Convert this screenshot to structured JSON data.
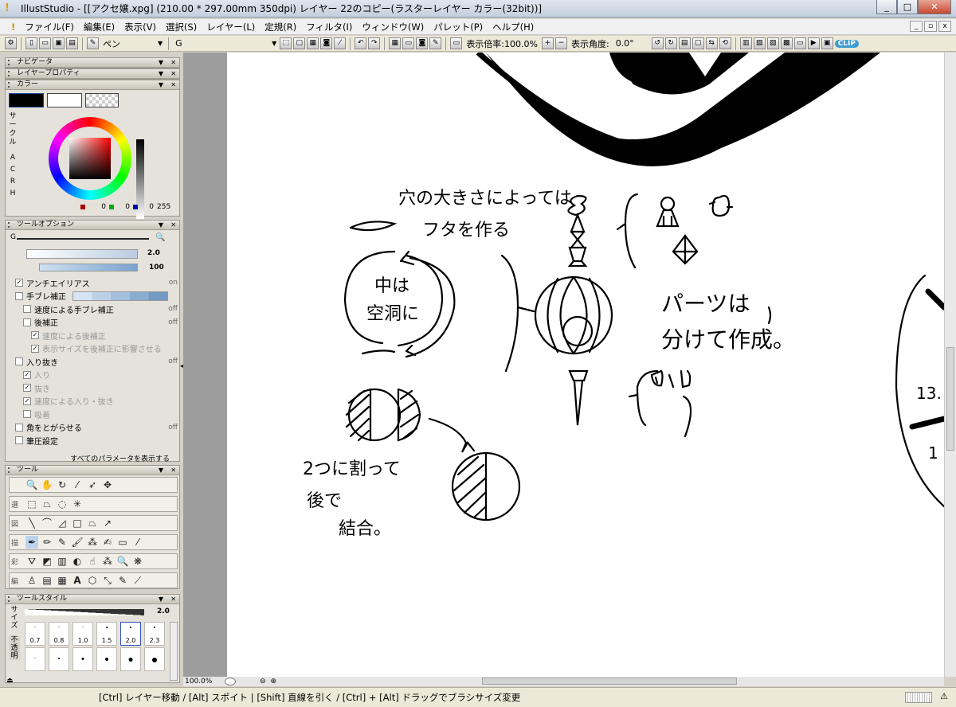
{
  "window": {
    "app_icon": "lightbulb-icon",
    "title": "IllustStudio - [[アクセ嬢.xpg] (210.00 * 297.00mm 350dpi)   レイヤー 22のコピー(ラスターレイヤー カラー(32bit))]",
    "buttons": [
      "_",
      "□",
      "✕"
    ]
  },
  "menu": {
    "items": [
      "ファイル(F)",
      "編集(E)",
      "表示(V)",
      "選択(S)",
      "レイヤー(L)",
      "定規(R)",
      "フィルタ(I)",
      "ウィンドウ(W)",
      "パレット(P)",
      "ヘルプ(H)"
    ],
    "mdi_buttons": [
      "_",
      "▫",
      "x"
    ]
  },
  "toolbar": {
    "tool_name": "ペン",
    "brush_label": "G",
    "zoom_label": "表示倍率:100.0%",
    "angle_label": "表示角度:",
    "angle_value": "0.0°",
    "badge": "CLIP"
  },
  "panels": {
    "navigator": "ナビゲータ",
    "layer_props": "レイヤープロパティ",
    "color": "カラー",
    "color_tabs": [
      "サ",
      "ー",
      "ク",
      "ル",
      "A",
      "C",
      "R",
      "H"
    ],
    "rgb_values": [
      "0",
      "0",
      "0",
      "255"
    ],
    "main_color": "#000000",
    "sub_color": "#ffffff",
    "tool_options": "ツールオプション",
    "brush_name": "G",
    "size_value": "2.0",
    "density_value": "100",
    "options": [
      {
        "label": "アンチエイリアス",
        "value": "on",
        "checked": true,
        "disabled": false,
        "indent": 0
      },
      {
        "label": "手ブレ補正",
        "value": "",
        "checked": false,
        "disabled": false,
        "indent": 0
      },
      {
        "label": "速度による手ブレ補正",
        "value": "off",
        "checked": false,
        "disabled": false,
        "indent": 1
      },
      {
        "label": "後補正",
        "value": "off",
        "checked": false,
        "disabled": false,
        "indent": 1
      },
      {
        "label": "速度による後補正",
        "value": "",
        "checked": true,
        "disabled": true,
        "indent": 2
      },
      {
        "label": "表示サイズを後補正に影響させる",
        "value": "",
        "checked": true,
        "disabled": true,
        "indent": 2
      },
      {
        "label": "入り抜き",
        "value": "off",
        "checked": false,
        "disabled": false,
        "indent": 0
      },
      {
        "label": "入り",
        "value": "",
        "checked": true,
        "disabled": true,
        "indent": 1
      },
      {
        "label": "抜き",
        "value": "",
        "checked": true,
        "disabled": true,
        "indent": 1
      },
      {
        "label": "速度による入り・抜き",
        "value": "",
        "checked": true,
        "disabled": true,
        "indent": 1
      },
      {
        "label": "吸着",
        "value": "",
        "checked": false,
        "disabled": true,
        "indent": 1
      },
      {
        "label": "角をとがらせる",
        "value": "off",
        "checked": false,
        "disabled": false,
        "indent": 0
      },
      {
        "label": "筆圧設定",
        "value": "",
        "checked": false,
        "disabled": false,
        "indent": 0
      }
    ],
    "show_all_params": "すべてのパラメータを表示する",
    "tools_title": "ツール",
    "tool_groups": [
      "選",
      "図",
      "描",
      "彩",
      "編"
    ],
    "tool_style_title": "ツールスタイル",
    "style_size_value": "2.0",
    "style_labels": [
      "サ",
      "イ",
      "ズ",
      "不",
      "透",
      "明"
    ],
    "brush_sizes": [
      "0.7",
      "0.8",
      "1.0",
      "1.5",
      "2.0",
      "2.3"
    ],
    "selected_brush": "2.0"
  },
  "canvas": {
    "notes": {
      "top": "穴の大きさによっては",
      "top2": "フタを作る",
      "inside1": "中は",
      "inside2": "空洞に",
      "parts1": "パーツは",
      "parts2": "分けて作成。",
      "split1": "2つに割って",
      "split2": "後で",
      "split3": "結合。",
      "dial": "13.",
      "dial2": "1"
    },
    "zoom_readout": "100.0%"
  },
  "status": {
    "hint": "[Ctrl] レイヤー移動 / [Alt] スポイト | [Shift] 直線を引く / [Ctrl] + [Alt] ドラッグでブラシサイズ変更"
  }
}
